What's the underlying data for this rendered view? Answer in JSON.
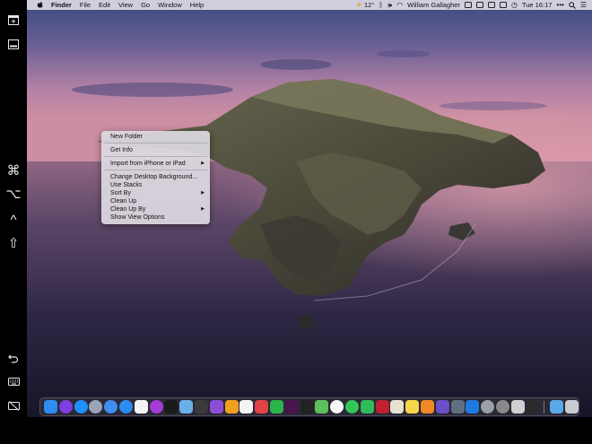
{
  "menubar": {
    "app_name": "Finder",
    "menus": [
      "File",
      "Edit",
      "View",
      "Go",
      "Window",
      "Help"
    ],
    "status": {
      "weather": "12°",
      "user": "William Gallagher",
      "clock": "Tue 16:17"
    }
  },
  "sidebar": {
    "modifiers": {
      "command": "⌘",
      "option": "⌥",
      "control": "^",
      "shift": "⇧"
    }
  },
  "context_menu": {
    "items": [
      {
        "label": "New Folder"
      },
      {
        "label": "Get Info"
      },
      {
        "label": "Import from iPhone or iPad"
      },
      {
        "label": "Change Desktop Background..."
      },
      {
        "label": "Use Stacks"
      },
      {
        "label": "Sort By"
      },
      {
        "label": "Clean Up"
      },
      {
        "label": "Clean Up By"
      },
      {
        "label": "Show View Options"
      }
    ],
    "submenu_arrow": "▶"
  },
  "dock": {
    "apps": [
      {
        "icon": "finder-icon",
        "color": "#2f8cf0"
      },
      {
        "icon": "siri-icon",
        "color": "#7b3fe4"
      },
      {
        "icon": "app-store-icon",
        "color": "#1e90ff"
      },
      {
        "icon": "launchpad-icon",
        "color": "#9aa4b4"
      },
      {
        "icon": "chrome-icon",
        "color": "#3e8ef0"
      },
      {
        "icon": "safari-icon",
        "color": "#2d8cf0"
      },
      {
        "icon": "music-icon",
        "color": "#f4f4f4"
      },
      {
        "icon": "podcasts-icon",
        "color": "#a43cd8"
      },
      {
        "icon": "apple-tv-icon",
        "color": "#1a1a1a"
      },
      {
        "icon": "preview-icon",
        "color": "#6ab0e8"
      },
      {
        "icon": "screenshot-icon",
        "color": "#3a3a3a"
      },
      {
        "icon": "omnifocus-icon",
        "color": "#8a4fd6"
      },
      {
        "icon": "reeder-icon",
        "color": "#f0a020"
      },
      {
        "icon": "calendar-icon",
        "color": "#f4f4f4"
      },
      {
        "icon": "fantastical-icon",
        "color": "#e04444"
      },
      {
        "icon": "numbers-icon",
        "color": "#2bb44a"
      },
      {
        "icon": "slack-icon",
        "color": "#4a154b"
      },
      {
        "icon": "final-cut-icon",
        "color": "#222222"
      },
      {
        "icon": "maps-icon",
        "color": "#5cbf5c"
      },
      {
        "icon": "photos-icon",
        "color": "#f8f8f8"
      },
      {
        "icon": "messages-icon",
        "color": "#34c759"
      },
      {
        "icon": "facetime-icon",
        "color": "#2ebd59"
      },
      {
        "icon": "photo-booth-icon",
        "color": "#c02030"
      },
      {
        "icon": "scrivener-icon",
        "color": "#e8e2d0"
      },
      {
        "icon": "notes-icon",
        "color": "#f7d54a"
      },
      {
        "icon": "pages-icon",
        "color": "#f08a24"
      },
      {
        "icon": "affinity-icon",
        "color": "#6a4fc8"
      },
      {
        "icon": "utility-icon",
        "color": "#607080"
      },
      {
        "icon": "keynote-icon",
        "color": "#1f7ae0"
      },
      {
        "icon": "disk-utility-icon",
        "color": "#9aa0a8"
      },
      {
        "icon": "system-preferences-icon",
        "color": "#8a8a8a"
      },
      {
        "icon": "script-editor-icon",
        "color": "#d0d0d0"
      },
      {
        "icon": "activity-monitor-icon",
        "color": "#2a2a2a"
      }
    ],
    "downloads": {
      "icon": "downloads-folder-icon",
      "color": "#5aa8e8"
    },
    "trash": {
      "icon": "trash-icon",
      "color": "#c8ccd2"
    }
  }
}
